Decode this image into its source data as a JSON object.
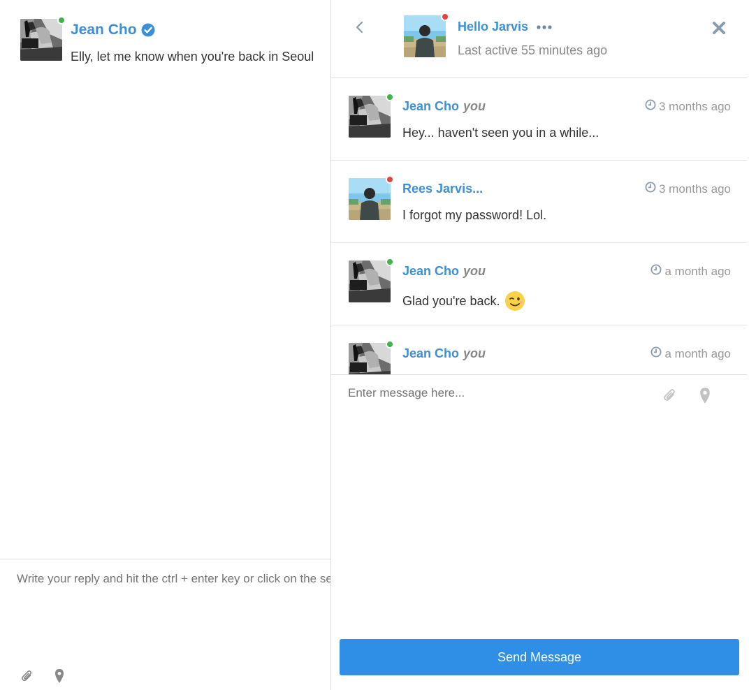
{
  "colors": {
    "accent": "#3d8fd6",
    "online": "#3cb54a",
    "offline": "#e0463d",
    "send_button": "#2f8fe6"
  },
  "left": {
    "conversation": {
      "name": "Jean Cho",
      "verified_icon": "verified-check-icon",
      "status": "online",
      "preview": "Elly, let me know when you're back in Seoul"
    },
    "reply": {
      "placeholder": "Write your reply and hit the ctrl + enter key or click on the send button",
      "icons": [
        "paperclip-icon",
        "map-pin-icon"
      ]
    }
  },
  "chat": {
    "header": {
      "back_icon": "chevron-left-icon",
      "title": "Hello Jarvis",
      "more_icon": "ellipsis-icon",
      "subtitle": "Last active 55 minutes ago",
      "close_icon": "close-icon",
      "status": "offline"
    },
    "messages": [
      {
        "name": "Jean Cho",
        "you": "you",
        "time": "3 months ago",
        "text": "Hey... haven't seen you in a while...",
        "status": "online",
        "avatar": "jean"
      },
      {
        "name": "Rees Jarvis...",
        "you": "",
        "time": "3 months ago",
        "text": "I forgot my password! Lol.",
        "status": "offline",
        "avatar": "rees"
      },
      {
        "name": "Jean Cho",
        "you": "you",
        "time": "a month ago",
        "text": "Glad you're back.",
        "emoji": "winking-face-emoji",
        "status": "online",
        "avatar": "jean"
      },
      {
        "name": "Jean Cho",
        "you": "you",
        "time": "a month ago",
        "text": "",
        "status": "online",
        "avatar": "jean"
      }
    ],
    "compose": {
      "placeholder": "Enter message here...",
      "icons": [
        "paperclip-icon",
        "map-pin-icon"
      ],
      "send_label": "Send Message"
    }
  }
}
